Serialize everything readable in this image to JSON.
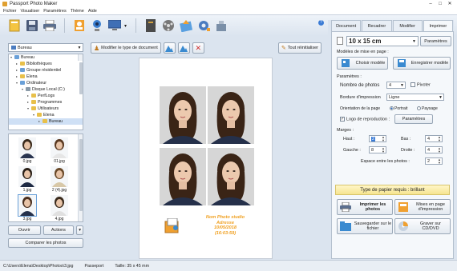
{
  "window": {
    "title": "Passport Photo Maker",
    "controls": [
      "–",
      "□",
      "✕"
    ]
  },
  "menu": [
    "Fichier",
    "Visualiser",
    "Paramètres",
    "Thème",
    "Aide"
  ],
  "toolbar_icons": [
    "open-icon",
    "save-icon",
    "print-icon",
    "contacts-icon",
    "webcam-icon",
    "screen-icon",
    "book-icon",
    "film-icon",
    "upload-icon",
    "gear-icon",
    "tools-icon"
  ],
  "left": {
    "folder_combo": "Bureau",
    "tree": [
      {
        "label": "Bureau",
        "depth": 0,
        "icon": "pc"
      },
      {
        "label": "Bibliothèques",
        "depth": 1,
        "icon": "f"
      },
      {
        "label": "Groupe résidentiel",
        "depth": 1,
        "icon": "pc"
      },
      {
        "label": "Elena",
        "depth": 1,
        "icon": "f"
      },
      {
        "label": "Ordinateur",
        "depth": 1,
        "icon": "pc"
      },
      {
        "label": "Disque Local (C:)",
        "depth": 2,
        "icon": "dr"
      },
      {
        "label": "PerfLogs",
        "depth": 3,
        "icon": "f"
      },
      {
        "label": "Programmes",
        "depth": 3,
        "icon": "f"
      },
      {
        "label": "Utilisateurs",
        "depth": 3,
        "icon": "f"
      },
      {
        "label": "Elena",
        "depth": 4,
        "icon": "f"
      },
      {
        "label": "Bureau",
        "depth": 5,
        "icon": "f"
      }
    ],
    "thumbnails": [
      "0.jpg",
      "01.jpg",
      "1.jpg",
      "2 (4).jpg",
      "3.jpg",
      "4.jpg"
    ],
    "open_label": "Ouvrir",
    "actions_label": "Actions",
    "compare_label": "Comparer les photos"
  },
  "center": {
    "change_type_label": "Modifier le type de document",
    "reset_label": "Tout réinitialiser",
    "info": [
      "Nom Photo studio",
      "Adresse",
      "10/05/2018",
      "(16:03:59)"
    ]
  },
  "right": {
    "tabs": [
      "Document",
      "Recadrer",
      "Modifier",
      "Imprimer"
    ],
    "paper_size": "10 x 15 cm",
    "params_btn": "Paramètres",
    "templates_title": "Modèles de mise en page :",
    "choose_template": "Choisir modèle",
    "save_template": "Enregistrer modèle",
    "params_title": "Paramètres :",
    "photo_count_label": "Nombre de photos",
    "photo_count": "4",
    "pivot_label": "Pivoter",
    "border_label": "Bordure d'impression",
    "border_value": "Ligne",
    "orientation_label": "Orientation de la page",
    "portrait": "Portrait",
    "landscape": "Paysage",
    "logo_label": "Logo de reproduction :",
    "logo_params": "Paramètres",
    "margins_title": "Marges :",
    "top_label": "Haut :",
    "top_value": "2",
    "bottom_label": "Bas :",
    "bottom_value": "4",
    "left_label": "Gauche :",
    "left_value": "8",
    "right_label": "Droite :",
    "right_value": "4",
    "spacing_label": "Espace entre les photos :",
    "spacing_value": "2",
    "paper_type": "Type de papier requis : brillant",
    "print_photos": "Imprimer les photos",
    "print_layout": "Mises en page d'impression",
    "save_file": "Sauvegarder sur le fichier",
    "burn_cd": "Graver sur CD/DVD"
  },
  "status": {
    "path": "C:\\Users\\Elena\\Desktop\\Photos\\3.jpg",
    "type": "Passeport",
    "size": "Taille: 35 x 45 mm"
  }
}
